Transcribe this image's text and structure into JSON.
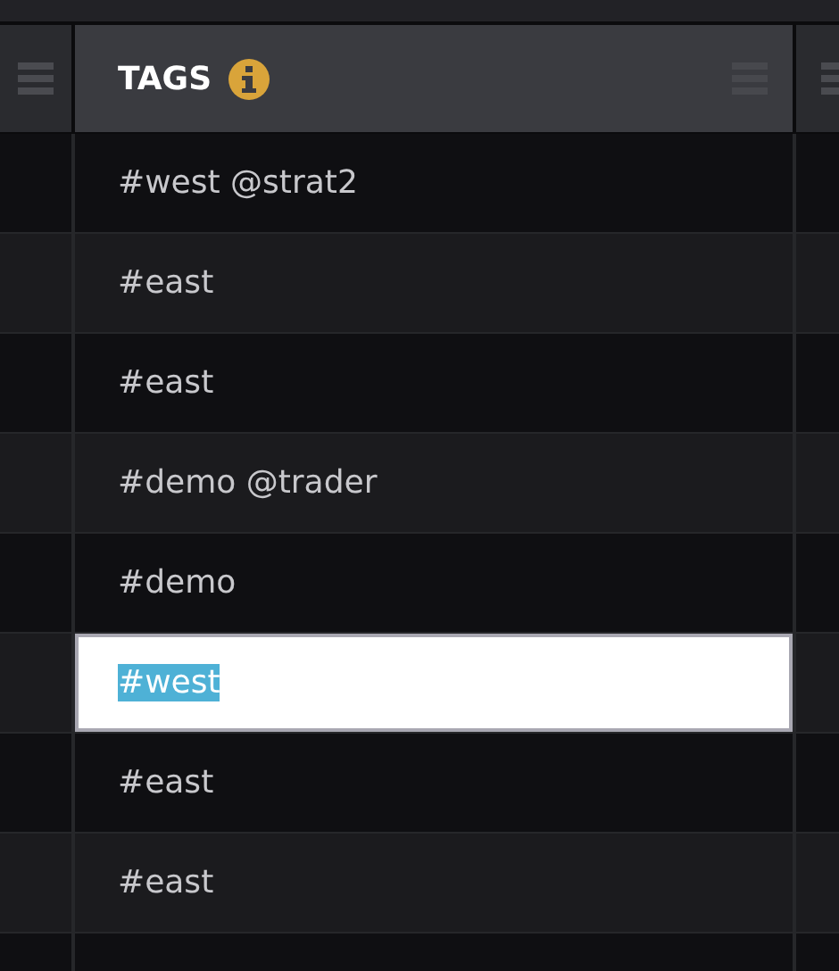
{
  "table": {
    "columns": [
      {
        "label": "TAGS"
      }
    ],
    "rows": [
      {
        "tags": "#west @strat2",
        "editing": false
      },
      {
        "tags": "#east",
        "editing": false
      },
      {
        "tags": "#east",
        "editing": false
      },
      {
        "tags": "#demo @trader",
        "editing": false
      },
      {
        "tags": "#demo",
        "editing": false
      },
      {
        "tags": "#west",
        "editing": true
      },
      {
        "tags": "#east",
        "editing": false
      },
      {
        "tags": "#east",
        "editing": false
      }
    ]
  }
}
